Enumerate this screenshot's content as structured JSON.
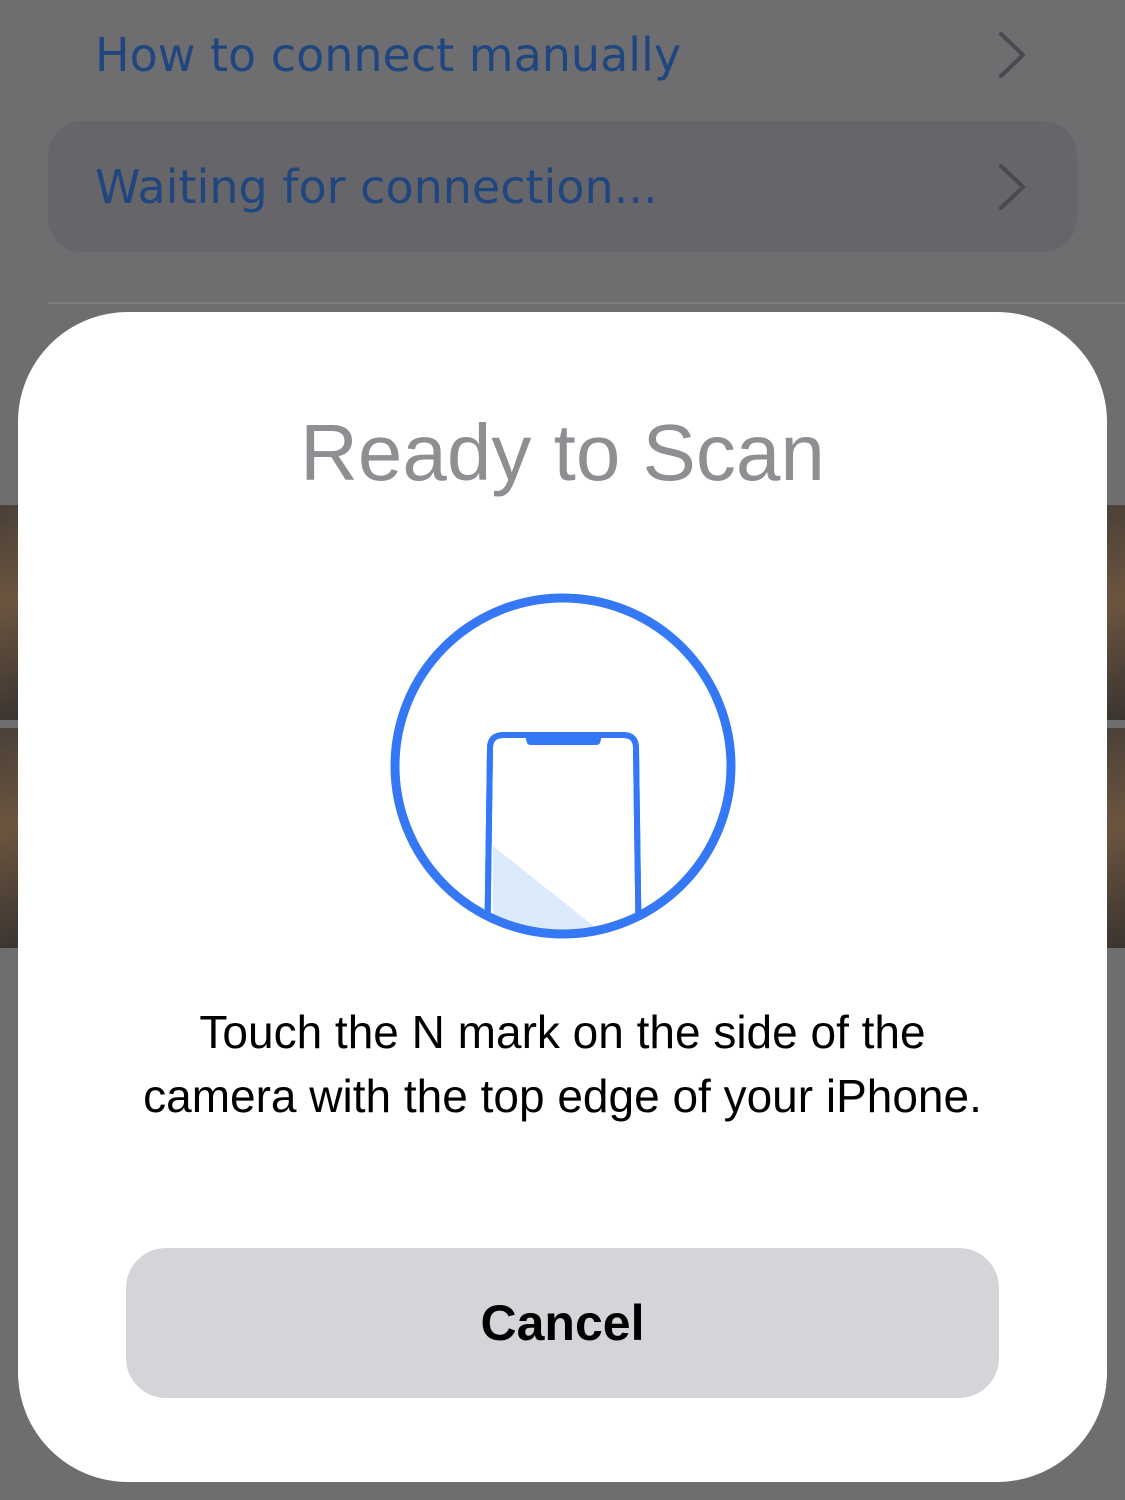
{
  "background_list": {
    "items": [
      {
        "label": "How to connect manually"
      },
      {
        "label": "Waiting for connection..."
      }
    ]
  },
  "sheet": {
    "title": "Ready to Scan",
    "illustration_icon": "phone-nfc-scan-icon",
    "message": "Touch the N mark on the side of the camera with the top edge of your iPhone.",
    "cancel_label": "Cancel"
  },
  "colors": {
    "accent": "#3478f6",
    "link_dimmed": "#20467f",
    "title_gray": "#8e8e93",
    "button_fill": "#d4d4d9",
    "dim_overlay": "#6e6e70"
  }
}
